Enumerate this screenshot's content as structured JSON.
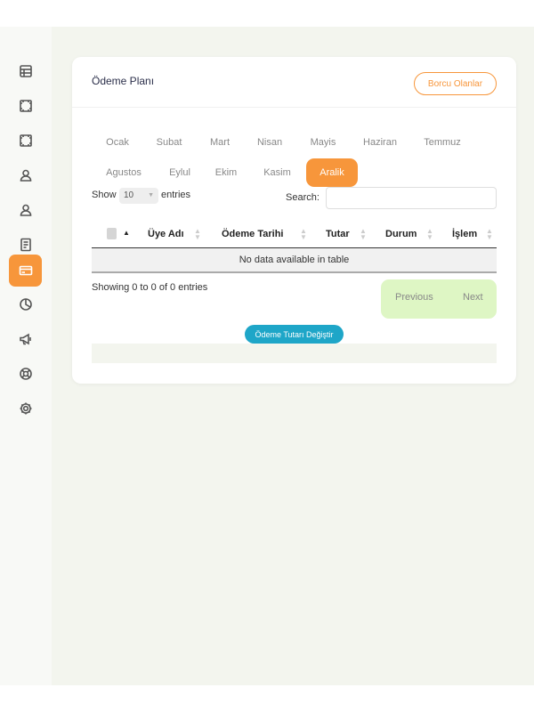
{
  "sidebar": {
    "items": [
      {
        "icon": "dashboard-icon"
      },
      {
        "icon": "frame-icon"
      },
      {
        "icon": "frame-icon"
      },
      {
        "icon": "user-icon"
      },
      {
        "icon": "user-icon"
      },
      {
        "icon": "document-icon"
      },
      {
        "icon": "credit-card-icon",
        "active": true
      },
      {
        "icon": "pie-chart-icon"
      },
      {
        "icon": "megaphone-icon"
      },
      {
        "icon": "support-icon"
      },
      {
        "icon": "settings-icon"
      }
    ],
    "accent_color": "#f7963b"
  },
  "card": {
    "title": "Ödeme Planı",
    "debt_button": "Borcu Olanlar"
  },
  "months": [
    "Ocak",
    "Subat",
    "Mart",
    "Nisan",
    "Mayis",
    "Haziran",
    "Temmuz",
    "Agustos",
    "Eylul",
    "Ekim",
    "Kasim",
    "Aralik"
  ],
  "active_month": "Aralik",
  "table_controls": {
    "show_label": "Show",
    "length_value": "10",
    "entries_label": "entries",
    "search_label": "Search:",
    "search_value": ""
  },
  "table": {
    "columns": [
      "Üye Adı",
      "Ödeme Tarihi",
      "Tutar",
      "Durum",
      "İşlem"
    ],
    "empty_message": "No data available in table",
    "info": "Showing 0 to 0 of 0 entries"
  },
  "pagination": {
    "previous": "Previous",
    "next": "Next"
  },
  "change_button": "Ödeme Tutarı Değiştir",
  "colors": {
    "accent": "#f7963b",
    "pagination_bg": "#def6c4",
    "action_button": "#1ea6c8"
  }
}
